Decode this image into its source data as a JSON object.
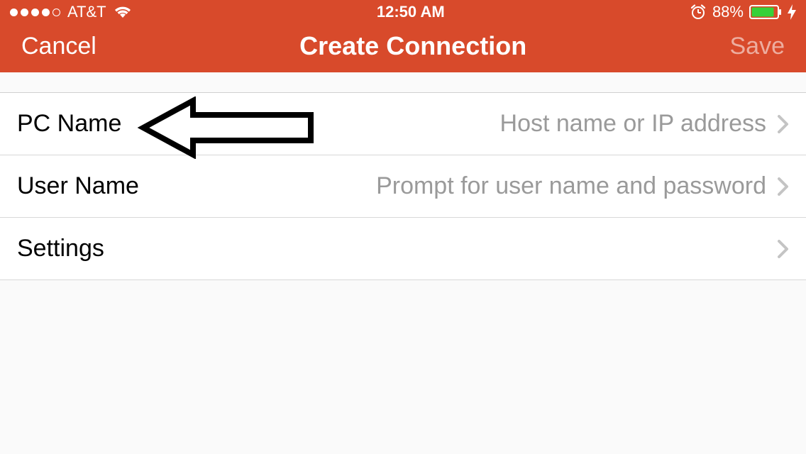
{
  "status": {
    "carrier": "AT&T",
    "time": "12:50 AM",
    "battery_pct": "88%"
  },
  "nav": {
    "cancel": "Cancel",
    "title": "Create Connection",
    "save": "Save"
  },
  "rows": {
    "pcname": {
      "label": "PC Name",
      "value": "Host name or IP address"
    },
    "username": {
      "label": "User Name",
      "value": "Prompt for user name and password"
    },
    "settings": {
      "label": "Settings",
      "value": ""
    }
  }
}
